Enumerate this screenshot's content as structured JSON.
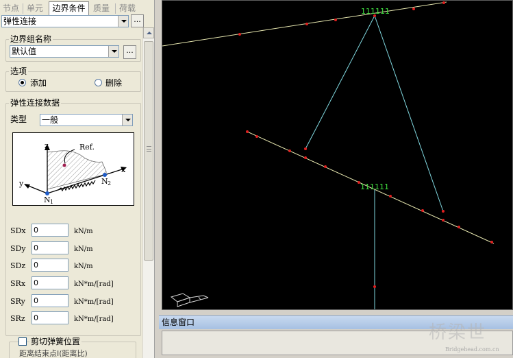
{
  "tabs": [
    {
      "label": "节点"
    },
    {
      "label": "单元"
    },
    {
      "label": "边界条件",
      "active": true
    },
    {
      "label": "质量"
    },
    {
      "label": "荷载"
    }
  ],
  "boundary_type_combo": {
    "value": "弹性连接"
  },
  "boundary_group": {
    "label": "边界组名称",
    "value": "默认值"
  },
  "options": {
    "label": "选项",
    "add_label": "添加",
    "delete_label": "删除",
    "selected": "添加"
  },
  "elastic_link": {
    "label": "弹性连接数据",
    "type_label": "类型",
    "type_value": "一般",
    "diagram": {
      "z": "z",
      "x": "x",
      "y": "y",
      "ref": "Ref.",
      "n1": "N",
      "n1_sub": "1",
      "n2": "N",
      "n2_sub": "2"
    },
    "fields": [
      {
        "label": "SDx",
        "value": "0",
        "unit": "kN/m"
      },
      {
        "label": "SDy",
        "value": "0",
        "unit": "kN/m"
      },
      {
        "label": "SDz",
        "value": "0",
        "unit": "kN/m"
      },
      {
        "label": "SRx",
        "value": "0",
        "unit": "kN*m/[rad]"
      },
      {
        "label": "SRy",
        "value": "0",
        "unit": "kN*m/[rad]"
      },
      {
        "label": "SRz",
        "value": "0",
        "unit": "kN*m/[rad]"
      }
    ]
  },
  "shear_spring": {
    "label": "剪切弹簧位置",
    "sub_label": "距离结束点I(距离比)"
  },
  "viewport": {
    "label_top": "111111",
    "label_mid": "111111",
    "colors": {
      "background": "#000000",
      "beam": "#e8e8b0",
      "link": "#80d8e0",
      "node": "#e02020",
      "label": "#40e040"
    }
  },
  "info_window": {
    "title": "信息窗口"
  },
  "watermark": {
    "text": "桥梁世",
    "url": "Bridgehead.com.cn"
  }
}
